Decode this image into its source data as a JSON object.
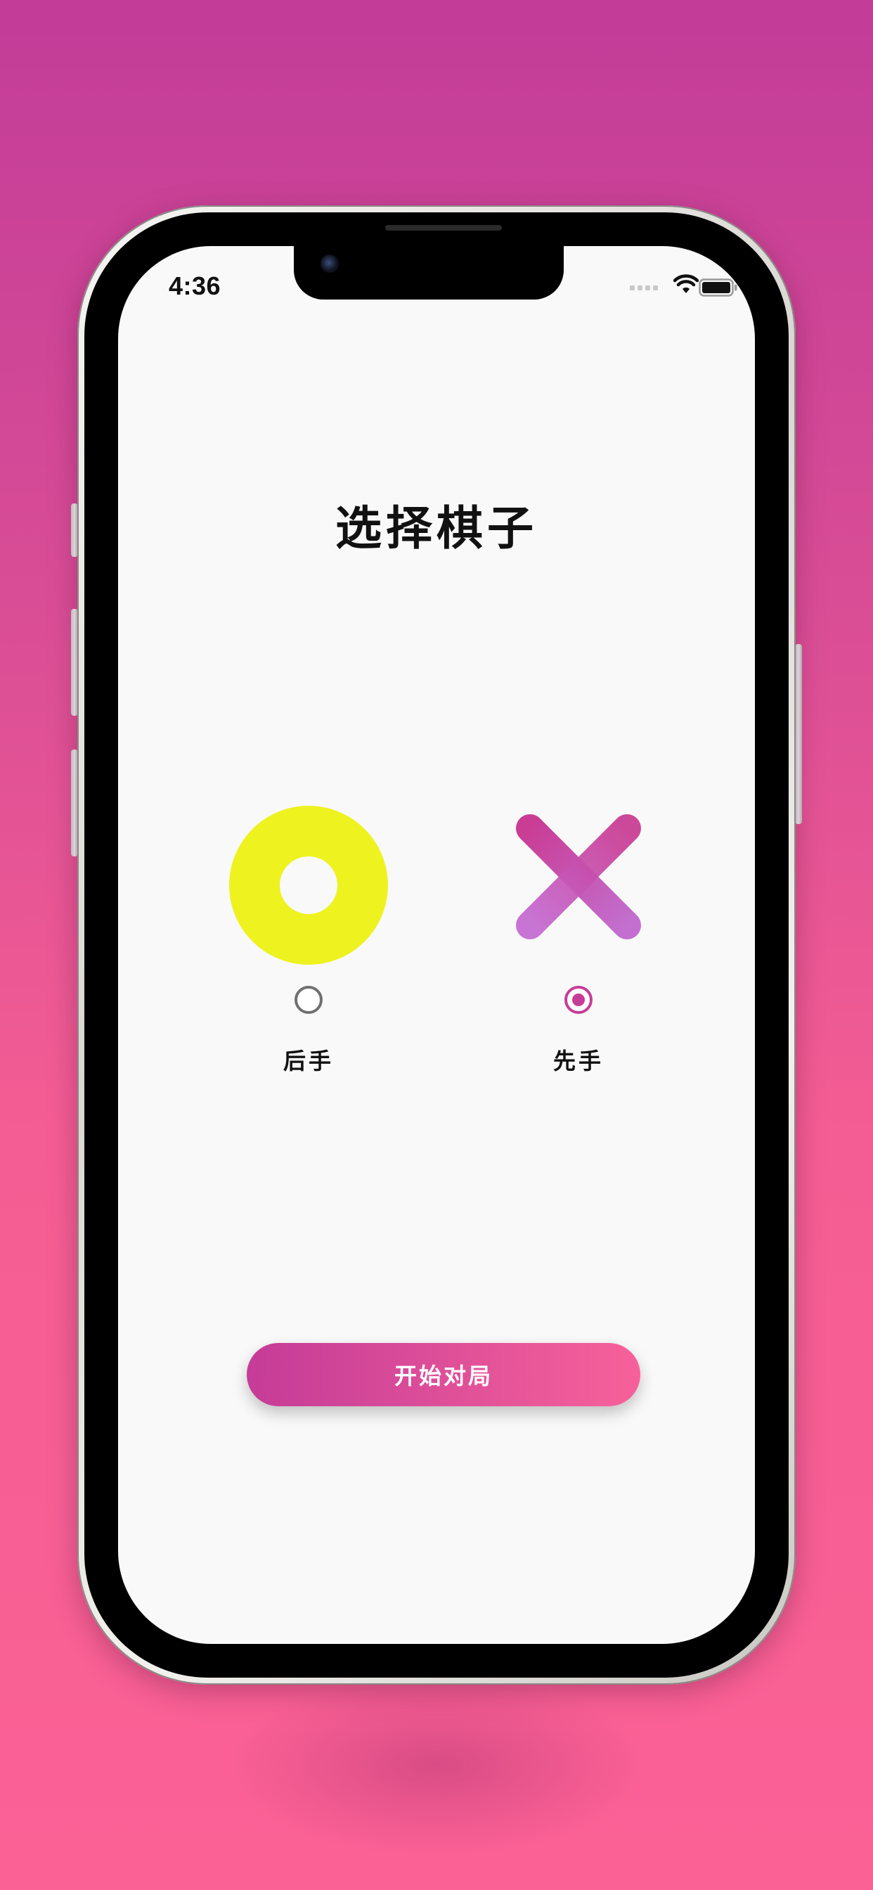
{
  "status_bar": {
    "time": "4:36",
    "icons": [
      "cellular-signal-icon",
      "wifi-icon",
      "battery-icon"
    ]
  },
  "screen": {
    "title": "选择棋子",
    "choices": [
      {
        "piece": "o-piece-icon",
        "label": "后手",
        "selected": false,
        "color": "#eef21f"
      },
      {
        "piece": "x-piece-icon",
        "label": "先手",
        "selected": true,
        "color": "#c63d97"
      }
    ],
    "start_button_label": "开始对局"
  },
  "colors": {
    "background_top": "#c23c98",
    "background_bottom": "#fb6195",
    "accent": "#c63d97",
    "o_yellow": "#eef21f",
    "button_gradient_start": "#c53c98",
    "button_gradient_end": "#f7619a"
  }
}
